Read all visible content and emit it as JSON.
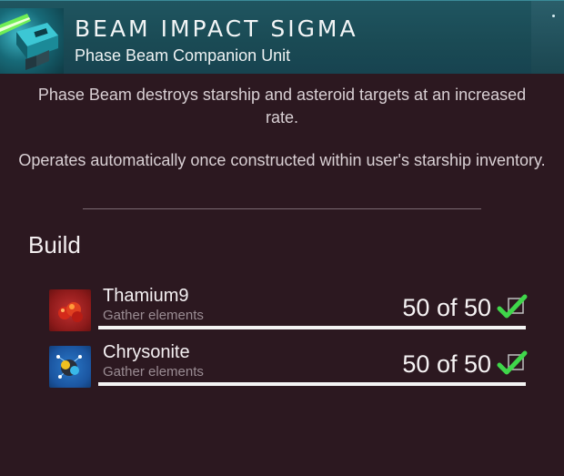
{
  "header": {
    "title": "BEAM IMPACT SIGMA",
    "subtitle": "Phase Beam Companion Unit",
    "product_icon": "phase-beam-module-icon",
    "accent_color": "#1f5560"
  },
  "description": {
    "line1": "Phase Beam destroys starship and asteroid targets at an increased rate.",
    "line2": "Operates automatically once constructed within user's starship inventory."
  },
  "build": {
    "heading": "Build",
    "requirements": [
      {
        "name": "Thamium9",
        "subtitle": "Gather elements",
        "count": "50 of 50",
        "progress": 1.0,
        "icon": "thamium9-resource-icon",
        "icon_color": "#8d1a1a",
        "status_icon": "check-icon"
      },
      {
        "name": "Chrysonite",
        "subtitle": "Gather elements",
        "count": "50 of 50",
        "progress": 1.0,
        "icon": "chrysonite-resource-icon",
        "icon_color": "#1b55a0",
        "status_icon": "check-icon"
      }
    ]
  }
}
